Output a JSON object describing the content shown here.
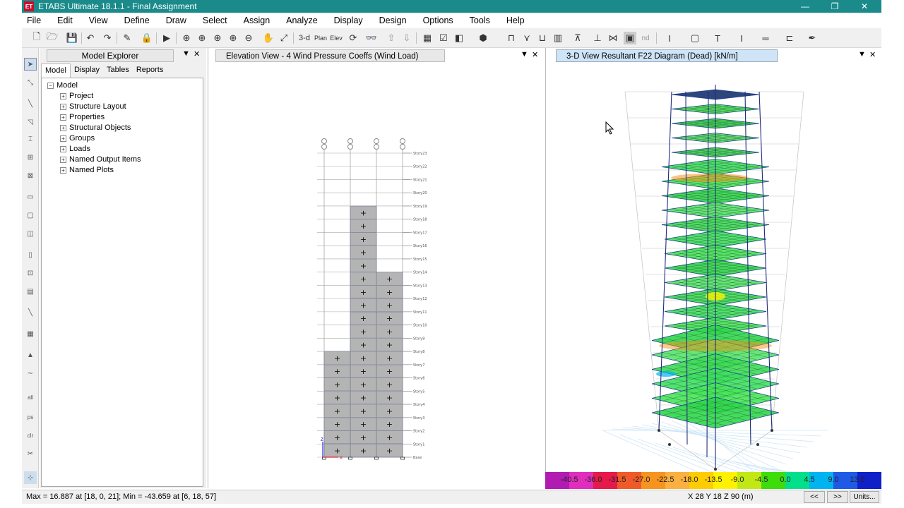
{
  "app": {
    "title": "ETABS Ultimate 18.1.1 - Final Assignment",
    "icon_text": "ET"
  },
  "window_controls": {
    "minimize": "—",
    "restore": "❐",
    "close": "✕"
  },
  "menu": [
    "File",
    "Edit",
    "View",
    "Define",
    "Draw",
    "Select",
    "Assign",
    "Analyze",
    "Display",
    "Design",
    "Options",
    "Tools",
    "Help"
  ],
  "toolbar": {
    "view_3d": "3-d",
    "plan": "Plan",
    "elev": "Elev",
    "nd": "nd"
  },
  "explorer": {
    "title": "Model Explorer",
    "tabs": [
      "Model",
      "Display",
      "Tables",
      "Reports"
    ],
    "root": "Model",
    "items": [
      "Project",
      "Structure Layout",
      "Properties",
      "Structural Objects",
      "Groups",
      "Loads",
      "Named Output Items",
      "Named Plots"
    ]
  },
  "elevation": {
    "title": "Elevation View - 4  Wind Pressure Coeffs (Wind Load)",
    "stories": [
      "Story23",
      "Story22",
      "Story21",
      "Story20",
      "Story19",
      "Story18",
      "Story17",
      "Story16",
      "Story15",
      "Story14",
      "Story13",
      "Story12",
      "Story11",
      "Story10",
      "Story9",
      "Story8",
      "Story7",
      "Story6",
      "Story5",
      "Story4",
      "Story3",
      "Story2",
      "Story1",
      "Base"
    ],
    "axis_x": "X",
    "axis_z": "Z"
  },
  "view3d": {
    "title": "3-D View   Resultant F22 Diagram    (Dead)  [kN/m]"
  },
  "legend": {
    "values": [
      "-40.5",
      "-36.0",
      "-31.5",
      "-27.0",
      "-22.5",
      "-18.0",
      "-13.5",
      "-9.0",
      "-4.5",
      "0.0",
      "4.5",
      "9.0",
      "13.5"
    ],
    "colors": [
      "#b21bb2",
      "#e02dbd",
      "#e6194b",
      "#f05a28",
      "#f7941d",
      "#fbb040",
      "#ffcc00",
      "#fff200",
      "#c2e813",
      "#3ddc0a",
      "#00e08c",
      "#00b4f0",
      "#1e5ae6",
      "#1020c8"
    ]
  },
  "status": {
    "maxmin": "Max = 16.887 at [18, 0, 21];  Min = -43.659 at [6, 18, 57]",
    "coords": "X 28  Y 18  Z 90 (m)",
    "prev": "<<",
    "next": ">>",
    "units": "Units..."
  }
}
